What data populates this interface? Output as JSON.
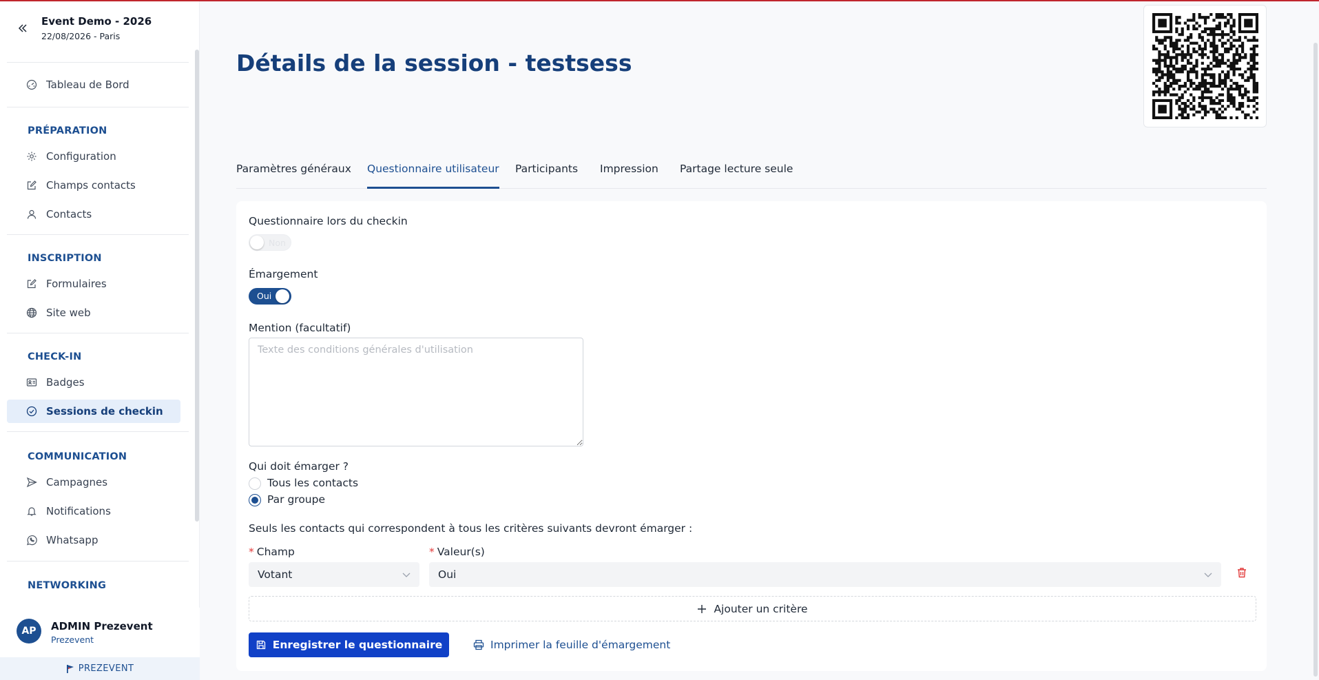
{
  "event": {
    "title": "Event Demo - 2026",
    "subtitle": "22/08/2026 - Paris"
  },
  "sidebar": {
    "dashboard": "Tableau de Bord",
    "sections": {
      "preparation": "PRÉPARATION",
      "inscription": "INSCRIPTION",
      "checkin": "CHECK-IN",
      "communication": "COMMUNICATION",
      "networking": "NETWORKING"
    },
    "items": {
      "configuration": "Configuration",
      "champs_contacts": "Champs contacts",
      "contacts": "Contacts",
      "formulaires": "Formulaires",
      "site_web": "Site web",
      "badges": "Badges",
      "sessions_checkin": "Sessions de checkin",
      "campagnes": "Campagnes",
      "notifications": "Notifications",
      "whatsapp": "Whatsapp"
    },
    "icons": {
      "dashboard": "gauge-icon",
      "configuration": "gear-icon",
      "champs_contacts": "edit-icon",
      "contacts": "user-icon",
      "formulaires": "edit-icon",
      "site_web": "globe-icon",
      "badges": "id-card-icon",
      "sessions_checkin": "check-circle-icon",
      "campagnes": "send-icon",
      "notifications": "bell-icon",
      "whatsapp": "whatsapp-icon"
    }
  },
  "user": {
    "initials": "AP",
    "name": "ADMIN Prezevent",
    "org": "Prezevent"
  },
  "brand": {
    "name": "PREZEVENT"
  },
  "page": {
    "title": "Détails de la session - testsess"
  },
  "tabs": {
    "general": "Paramètres généraux",
    "questionnaire": "Questionnaire utilisateur",
    "participants": "Participants",
    "impression": "Impression",
    "partage": "Partage lecture seule"
  },
  "form": {
    "checkin_questionnaire": {
      "label": "Questionnaire lors du checkin",
      "toggle_text": "Non",
      "enabled": false
    },
    "emargement": {
      "label": "Émargement",
      "toggle_text": "Oui",
      "enabled": true
    },
    "mention": {
      "label": "Mention (facultatif)",
      "placeholder": "Texte des conditions générales d'utilisation",
      "value": ""
    },
    "who": {
      "label": "Qui doit émarger ?",
      "options": [
        "Tous les contacts",
        "Par groupe"
      ],
      "selected": "Par groupe"
    },
    "criteria_intro": "Seuls les contacts qui correspondent à tous les critères suivants devront émarger :",
    "criteria": {
      "field_label": "Champ",
      "values_label": "Valeur(s)",
      "field_value": "Votant",
      "values_value": "Oui"
    },
    "add_criterion": "Ajouter un critère",
    "save_button": "Enregistrer le questionnaire",
    "print_button": "Imprimer la feuille d'émargement"
  },
  "colors": {
    "accent": "#1d4f91",
    "primary_button": "#1141c7",
    "danger": "#e23b3b",
    "top_bar": "#c0262d"
  }
}
